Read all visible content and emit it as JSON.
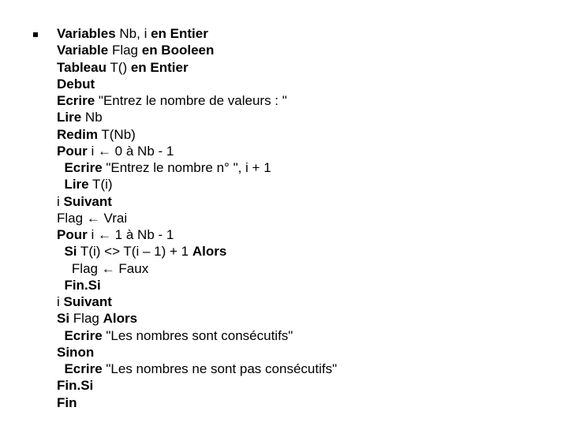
{
  "code": {
    "lines": [
      {
        "indent": 0,
        "segments": [
          {
            "b": true,
            "t": "Variables"
          },
          {
            "b": false,
            "t": " Nb, i "
          },
          {
            "b": true,
            "t": "en Entier"
          }
        ]
      },
      {
        "indent": 0,
        "segments": [
          {
            "b": true,
            "t": "Variable"
          },
          {
            "b": false,
            "t": " Flag "
          },
          {
            "b": true,
            "t": "en Booleen"
          }
        ]
      },
      {
        "indent": 0,
        "segments": [
          {
            "b": true,
            "t": "Tableau"
          },
          {
            "b": false,
            "t": " T() "
          },
          {
            "b": true,
            "t": "en Entier"
          }
        ]
      },
      {
        "indent": 0,
        "segments": [
          {
            "b": true,
            "t": "Debut"
          }
        ]
      },
      {
        "indent": 0,
        "segments": [
          {
            "b": true,
            "t": "Ecrire"
          },
          {
            "b": false,
            "t": " \"Entrez le nombre de valeurs : \""
          }
        ]
      },
      {
        "indent": 0,
        "segments": [
          {
            "b": true,
            "t": "Lire"
          },
          {
            "b": false,
            "t": " Nb"
          }
        ]
      },
      {
        "indent": 0,
        "segments": [
          {
            "b": true,
            "t": "Redim"
          },
          {
            "b": false,
            "t": " T(Nb)"
          }
        ]
      },
      {
        "indent": 0,
        "segments": [
          {
            "b": true,
            "t": "Pour"
          },
          {
            "b": false,
            "t": " i ← 0 à Nb - 1"
          }
        ]
      },
      {
        "indent": 1,
        "segments": [
          {
            "b": true,
            "t": "Ecrire"
          },
          {
            "b": false,
            "t": " \"Entrez le nombre n° \", i + 1"
          }
        ]
      },
      {
        "indent": 1,
        "segments": [
          {
            "b": true,
            "t": "Lire"
          },
          {
            "b": false,
            "t": " T(i)"
          }
        ]
      },
      {
        "indent": 0,
        "segments": [
          {
            "b": false,
            "t": "i "
          },
          {
            "b": true,
            "t": "Suivant"
          }
        ]
      },
      {
        "indent": 0,
        "segments": [
          {
            "b": false,
            "t": "Flag ← Vrai"
          }
        ]
      },
      {
        "indent": 0,
        "segments": [
          {
            "b": true,
            "t": "Pour"
          },
          {
            "b": false,
            "t": " i ← 1 à Nb - 1"
          }
        ]
      },
      {
        "indent": 1,
        "segments": [
          {
            "b": true,
            "t": "Si"
          },
          {
            "b": false,
            "t": " T(i) <> T(i – 1) + 1 "
          },
          {
            "b": true,
            "t": "Alors"
          }
        ]
      },
      {
        "indent": 2,
        "segments": [
          {
            "b": false,
            "t": "Flag ← Faux"
          }
        ]
      },
      {
        "indent": 1,
        "segments": [
          {
            "b": true,
            "t": "Fin.Si"
          }
        ]
      },
      {
        "indent": 0,
        "segments": [
          {
            "b": false,
            "t": "i "
          },
          {
            "b": true,
            "t": "Suivant"
          }
        ]
      },
      {
        "indent": 0,
        "segments": [
          {
            "b": true,
            "t": "Si"
          },
          {
            "b": false,
            "t": " Flag "
          },
          {
            "b": true,
            "t": "Alors"
          }
        ]
      },
      {
        "indent": 1,
        "segments": [
          {
            "b": true,
            "t": "Ecrire"
          },
          {
            "b": false,
            "t": " \"Les nombres sont consécutifs\""
          }
        ]
      },
      {
        "indent": 0,
        "segments": [
          {
            "b": true,
            "t": "Sinon"
          }
        ]
      },
      {
        "indent": 1,
        "segments": [
          {
            "b": true,
            "t": "Ecrire"
          },
          {
            "b": false,
            "t": " \"Les nombres ne sont pas consécutifs\""
          }
        ]
      },
      {
        "indent": 0,
        "segments": [
          {
            "b": true,
            "t": "Fin.Si"
          }
        ]
      },
      {
        "indent": 0,
        "segments": [
          {
            "b": true,
            "t": "Fin"
          }
        ]
      }
    ]
  }
}
